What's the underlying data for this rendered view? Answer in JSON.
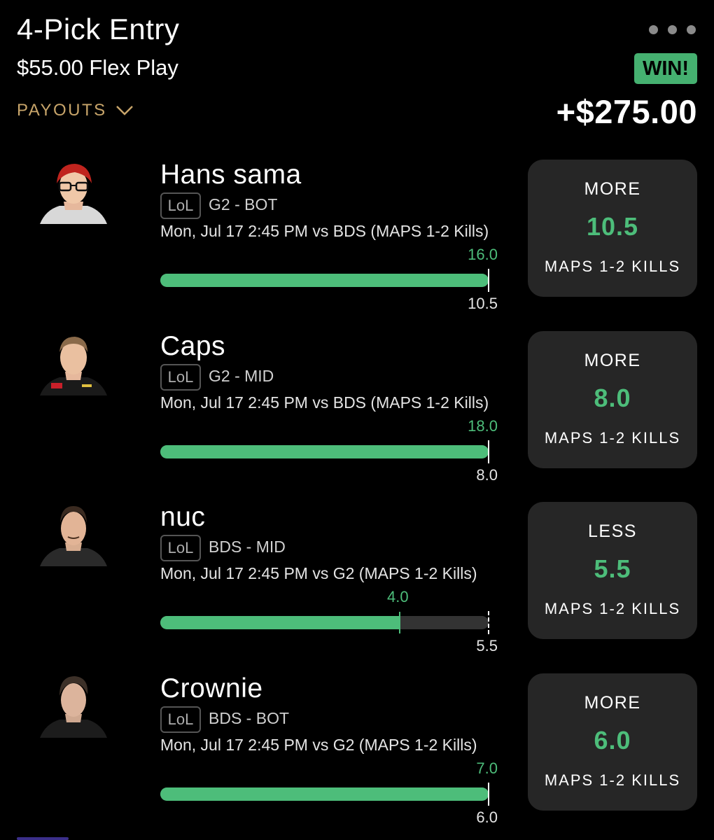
{
  "header": {
    "title": "4-Pick Entry",
    "subtitle": "$55.00 Flex Play",
    "payouts_label": "PAYOUTS",
    "status_badge": "WIN!",
    "winnings": "+$275.00"
  },
  "picks": [
    {
      "player": "Hans sama",
      "league": "LoL",
      "team_position": "G2 - BOT",
      "matchup": "Mon, Jul 17 2:45 PM  vs BDS (MAPS 1-2 Kills)",
      "actual": "16.0",
      "line": "10.5",
      "progress": 1.0,
      "direction": "MORE",
      "card_line": "10.5",
      "stat": "MAPS 1-2 KILLS"
    },
    {
      "player": "Caps",
      "league": "LoL",
      "team_position": "G2 - MID",
      "matchup": "Mon, Jul 17 2:45 PM  vs BDS (MAPS 1-2 Kills)",
      "actual": "18.0",
      "line": "8.0",
      "progress": 1.0,
      "direction": "MORE",
      "card_line": "8.0",
      "stat": "MAPS 1-2 KILLS"
    },
    {
      "player": "nuc",
      "league": "LoL",
      "team_position": "BDS - MID",
      "matchup": "Mon, Jul 17 2:45 PM  vs G2 (MAPS 1-2 Kills)",
      "actual": "4.0",
      "line": "5.5",
      "progress": 0.727,
      "direction": "LESS",
      "card_line": "5.5",
      "stat": "MAPS 1-2 KILLS"
    },
    {
      "player": "Crownie",
      "league": "LoL",
      "team_position": "BDS - BOT",
      "matchup": "Mon, Jul 17 2:45 PM  vs G2 (MAPS 1-2 Kills)",
      "actual": "7.0",
      "line": "6.0",
      "progress": 1.0,
      "direction": "MORE",
      "card_line": "6.0",
      "stat": "MAPS 1-2 KILLS"
    }
  ],
  "colors": {
    "accent_green": "#4dbd7a",
    "win_badge": "#45b070",
    "payouts_gold": "#c8a56a",
    "card_bg": "#262626"
  }
}
